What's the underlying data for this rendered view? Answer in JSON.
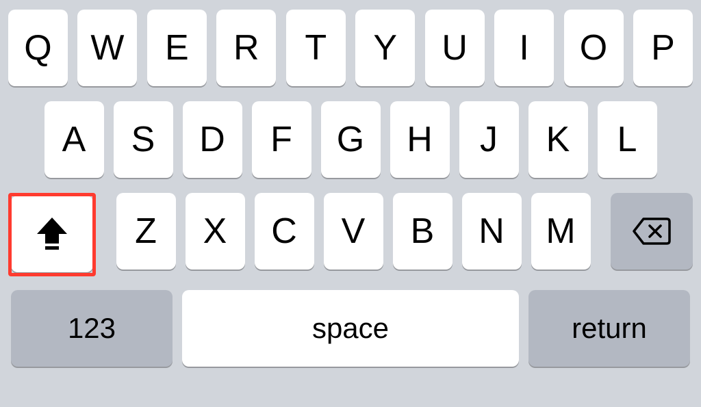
{
  "rows": {
    "r1": [
      "Q",
      "W",
      "E",
      "R",
      "T",
      "Y",
      "U",
      "I",
      "O",
      "P"
    ],
    "r2": [
      "A",
      "S",
      "D",
      "F",
      "G",
      "H",
      "J",
      "K",
      "L"
    ],
    "r3": [
      "Z",
      "X",
      "C",
      "V",
      "B",
      "N",
      "M"
    ]
  },
  "fn": {
    "numbers": "123",
    "space": "space",
    "return": "return"
  },
  "icons": {
    "shift": "shift-icon",
    "backspace": "backspace-icon"
  },
  "colors": {
    "highlight": "#ff3b2f",
    "key_bg": "#ffffff",
    "fn_bg": "#b3b8c2",
    "board_bg": "#d1d5db"
  }
}
